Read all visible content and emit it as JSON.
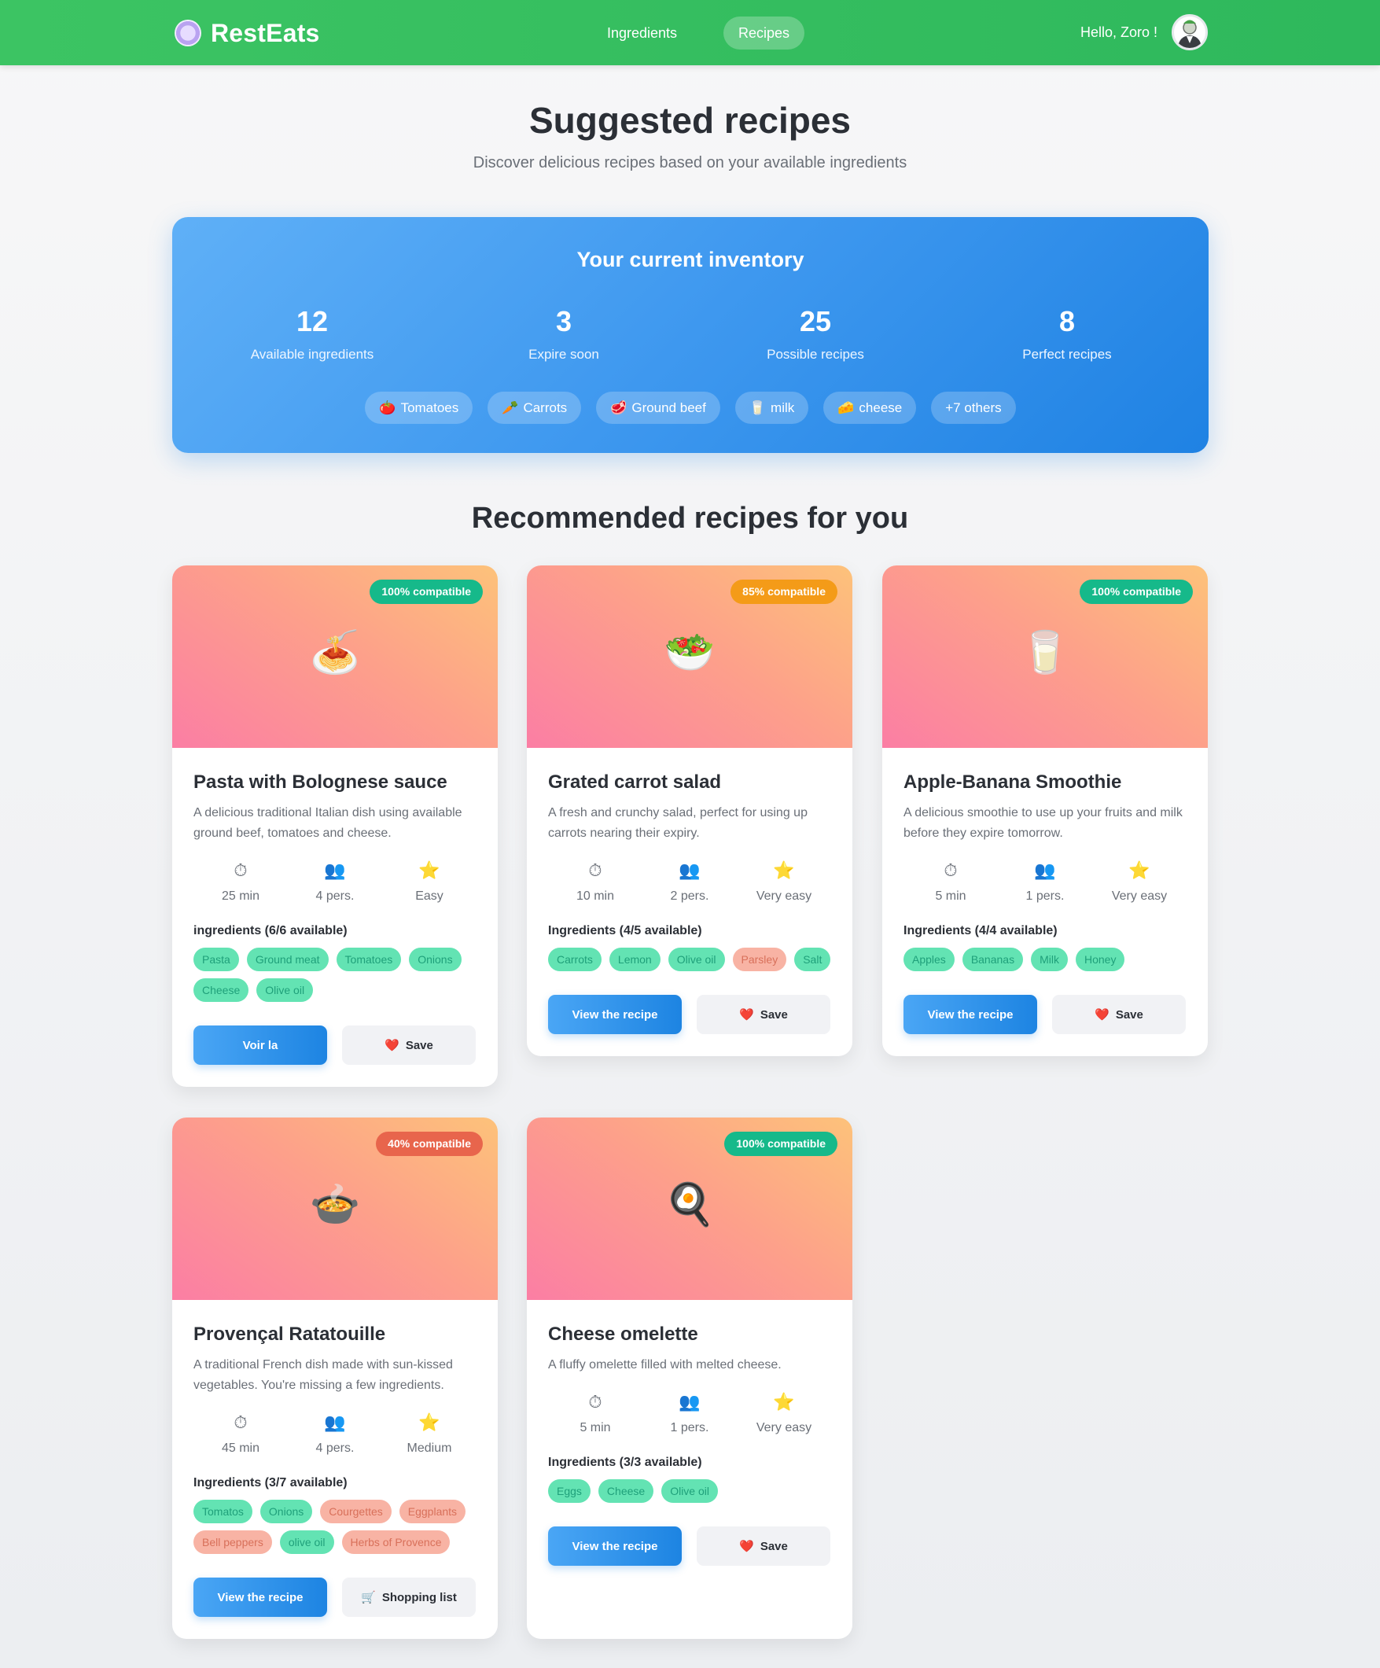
{
  "nav": {
    "brand": "RestEats",
    "brand_icon": "plate-icon",
    "links": [
      {
        "label": "Ingredients",
        "active": false
      },
      {
        "label": "Recipes",
        "active": true
      }
    ],
    "greeting": "Hello, Zoro !",
    "avatar_icon": "avatar-icon"
  },
  "page": {
    "title": "Suggested recipes",
    "subtitle": "Discover delicious recipes based on your available ingredients"
  },
  "inventory": {
    "title": "Your current inventory",
    "stats": [
      {
        "value": "12",
        "label": "Available ingredients"
      },
      {
        "value": "3",
        "label": "Expire soon"
      },
      {
        "value": "25",
        "label": "Possible recipes"
      },
      {
        "value": "8",
        "label": "Perfect recipes"
      }
    ],
    "chips": [
      {
        "icon": "🍅",
        "label": "Tomatoes"
      },
      {
        "icon": "🥕",
        "label": "Carrots"
      },
      {
        "icon": "🥩",
        "label": "Ground beef"
      },
      {
        "icon": "🥛",
        "label": "milk"
      },
      {
        "icon": "🧀",
        "label": "cheese"
      },
      {
        "icon": "",
        "label": "+7 others"
      }
    ]
  },
  "section_title": "Recommended recipes for you",
  "meta_icons": {
    "time": "⏱",
    "people": "👥",
    "difficulty": "⭐"
  },
  "colors": {
    "nav_green": "#3cc463",
    "inventory_blue": "#3e98ef",
    "badge_green": "#16b98a",
    "badge_orange": "#f49b18",
    "badge_red": "#e8654c",
    "tag_available": "#63e3b3",
    "tag_missing": "#f8b3a4"
  },
  "recipes": [
    {
      "emoji": "🍝",
      "badge": "100% compatible",
      "title": "Pasta with Bolognese sauce",
      "description": "A delicious traditional Italian dish using available ground beef, tomatoes and cheese.",
      "time": "25 min",
      "people": "4 pers.",
      "difficulty": "Easy",
      "ingredients_title": "ingredients (6/6 available)",
      "primary_label": "Voir la",
      "secondary_icon": "❤️",
      "secondary_label": "Save"
    },
    {
      "emoji": "🥗",
      "badge": "85% compatible",
      "title": "Grated carrot salad",
      "description": "A fresh and crunchy salad, perfect for using up carrots nearing their expiry.",
      "time": "10 min",
      "people": "2 pers.",
      "difficulty": "Very easy",
      "ingredients_title": "Ingredients (4/5 available)",
      "primary_label": "View the recipe",
      "secondary_icon": "❤️",
      "secondary_label": "Save"
    },
    {
      "emoji": "🥛",
      "badge": "100% compatible",
      "title": "Apple-Banana Smoothie",
      "description": "A delicious smoothie to use up your fruits and milk before they expire tomorrow.",
      "time": "5 min",
      "people": "1 pers.",
      "difficulty": "Very easy",
      "ingredients_title": "Ingredients (4/4 available)",
      "primary_label": "View the recipe",
      "secondary_icon": "❤️",
      "secondary_label": "Save"
    },
    {
      "emoji": "🍲",
      "badge": "40% compatible",
      "title": "Provençal Ratatouille",
      "description": "A traditional French dish made with sun-kissed vegetables. You're missing a few ingredients.",
      "time": "45 min",
      "people": "4 pers.",
      "difficulty": "Medium",
      "ingredients_title": "Ingredients (3/7 available)",
      "primary_label": "View the recipe",
      "secondary_icon": "🛒",
      "secondary_label": "Shopping list"
    },
    {
      "emoji": "🍳",
      "badge": "100% compatible",
      "title": "Cheese omelette",
      "description": "A fluffy omelette filled with melted cheese.",
      "time": "5 min",
      "people": "1 pers.",
      "difficulty": "Very easy",
      "ingredients_title": "Ingredients (3/3 available)",
      "primary_label": "View the recipe",
      "secondary_icon": "❤️",
      "secondary_label": "Save"
    }
  ],
  "recipe_tags": [
    [
      {
        "label": "Pasta",
        "available": true
      },
      {
        "label": "Ground meat",
        "available": true
      },
      {
        "label": "Tomatoes",
        "available": true
      },
      {
        "label": "Onions",
        "available": true
      },
      {
        "label": "Cheese",
        "available": true
      },
      {
        "label": "Olive oil",
        "available": true
      }
    ],
    [
      {
        "label": "Carrots",
        "available": true
      },
      {
        "label": "Lemon",
        "available": true
      },
      {
        "label": "Olive oil",
        "available": true
      },
      {
        "label": "Parsley",
        "available": false
      },
      {
        "label": "Salt",
        "available": true
      }
    ],
    [
      {
        "label": "Apples",
        "available": true
      },
      {
        "label": "Bananas",
        "available": true
      },
      {
        "label": "Milk",
        "available": true
      },
      {
        "label": "Honey",
        "available": true
      }
    ],
    [
      {
        "label": "Tomatos",
        "available": true
      },
      {
        "label": "Onions",
        "available": true
      },
      {
        "label": "Courgettes",
        "available": false
      },
      {
        "label": "Eggplants",
        "available": false
      },
      {
        "label": "Bell peppers",
        "available": false
      },
      {
        "label": "olive oil",
        "available": true
      },
      {
        "label": "Herbs of Provence",
        "available": false
      }
    ],
    [
      {
        "label": "Eggs",
        "available": true
      },
      {
        "label": "Cheese",
        "available": true
      },
      {
        "label": "Olive oil",
        "available": true
      }
    ]
  ]
}
